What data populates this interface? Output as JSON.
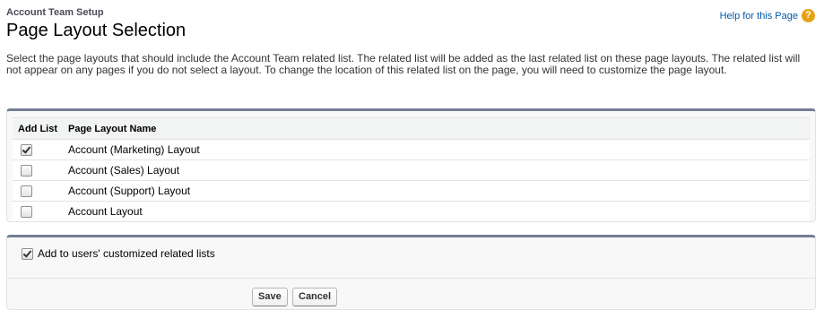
{
  "header": {
    "section": "Account Team Setup",
    "title": "Page Layout Selection",
    "help_label": "Help for this Page",
    "help_icon": "question-icon"
  },
  "description": "Select the page layouts that should include the Account Team related list. The related list will be added as the last related list on these page layouts. The related list will not appear on any pages if you do not select a layout. To change the location of this related list on the page, you will need to customize the page layout.",
  "table": {
    "columns": [
      "Add List",
      "Page Layout Name"
    ],
    "rows": [
      {
        "checked": true,
        "name": "Account (Marketing) Layout"
      },
      {
        "checked": false,
        "name": "Account (Sales) Layout"
      },
      {
        "checked": false,
        "name": "Account (Support) Layout"
      },
      {
        "checked": false,
        "name": "Account Layout"
      }
    ]
  },
  "options": {
    "add_to_custom_label": "Add to users' customized related lists",
    "add_to_custom_checked": true
  },
  "buttons": {
    "save": "Save",
    "cancel": "Cancel"
  },
  "colors": {
    "accent_border": "#747e96",
    "link": "#015ba7",
    "help_icon": "#e7a114"
  }
}
